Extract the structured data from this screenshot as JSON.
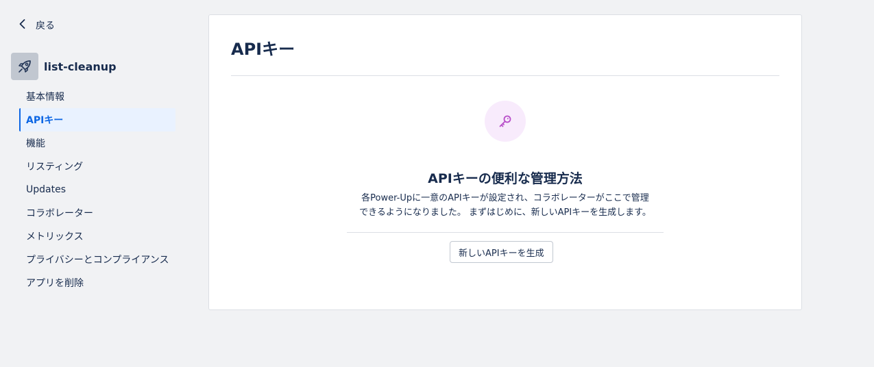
{
  "sidebar": {
    "back_label": "戻る",
    "app_name": "list-cleanup",
    "app_icon": "rocket-icon",
    "items": [
      {
        "label": "基本情報",
        "active": false
      },
      {
        "label": "APIキー",
        "active": true
      },
      {
        "label": "機能",
        "active": false
      },
      {
        "label": "リスティング",
        "active": false
      },
      {
        "label": "Updates",
        "active": false
      },
      {
        "label": "コラボレーター",
        "active": false
      },
      {
        "label": "メトリックス",
        "active": false
      },
      {
        "label": "プライバシーとコンプライアンス",
        "active": false
      },
      {
        "label": "アプリを削除",
        "active": false
      }
    ]
  },
  "main": {
    "title": "APIキー",
    "empty_state": {
      "icon": "key-icon",
      "title": "APIキーの便利な管理方法",
      "description_line1": "各Power-Upに一意のAPIキーが設定され、コラボレーターがここで管理",
      "description_line2": "できるようになりました。 まずはじめに、新しいAPIキーを生成します。",
      "button_label": "新しいAPIキーを生成"
    }
  },
  "colors": {
    "accent": "#0c66e4",
    "active_bg": "#e9f2ff",
    "key_icon": "#b84fc9",
    "key_bg": "#f8ebfc",
    "page_bg": "#f1f2f4"
  }
}
